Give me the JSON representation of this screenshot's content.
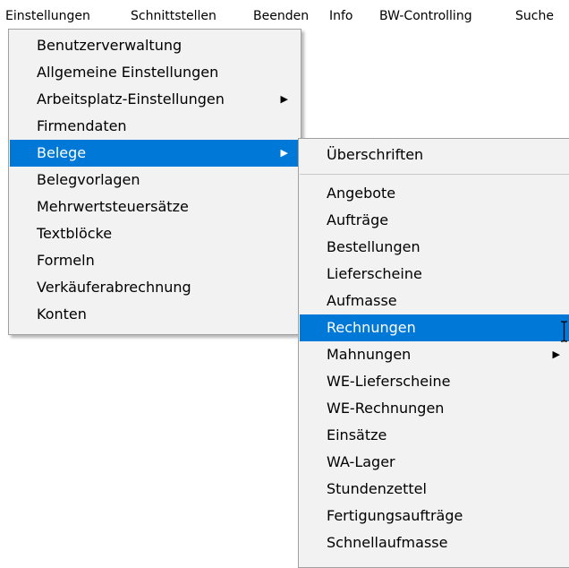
{
  "menubar": {
    "items": [
      {
        "label": "Einstellungen"
      },
      {
        "label": "Schnittstellen"
      },
      {
        "label": "Beenden"
      },
      {
        "label": "Info"
      },
      {
        "label": "BW-Controlling"
      },
      {
        "label": "Suche"
      }
    ]
  },
  "einstellungen_menu": {
    "items": [
      {
        "label": "Benutzerverwaltung"
      },
      {
        "label": "Allgemeine Einstellungen"
      },
      {
        "label": "Arbeitsplatz-Einstellungen",
        "submenu_icon": "chevron-right-icon"
      },
      {
        "label": "Firmendaten"
      },
      {
        "label": "Belege",
        "selected": true,
        "submenu_icon": "chevron-right-icon"
      },
      {
        "label": "Belegvorlagen"
      },
      {
        "label": "Mehrwertsteuersätze"
      },
      {
        "label": "Textblöcke"
      },
      {
        "label": "Formeln"
      },
      {
        "label": "Verkäuferabrechnung"
      },
      {
        "label": "Konten"
      }
    ]
  },
  "belege_submenu": {
    "items": [
      {
        "label": "Überschriften"
      },
      {
        "label": "Angebote"
      },
      {
        "label": "Aufträge"
      },
      {
        "label": "Bestellungen"
      },
      {
        "label": "Lieferscheine"
      },
      {
        "label": "Aufmasse"
      },
      {
        "label": "Rechnungen",
        "selected": true
      },
      {
        "label": "Mahnungen",
        "submenu_icon": "chevron-right-icon"
      },
      {
        "label": "WE-Lieferscheine"
      },
      {
        "label": "WE-Rechnungen"
      },
      {
        "label": "Einsätze"
      },
      {
        "label": "WA-Lager"
      },
      {
        "label": "Stundenzettel"
      },
      {
        "label": "Fertigungsaufträge"
      },
      {
        "label": "Schnellaufmasse"
      }
    ]
  },
  "colors": {
    "menu_background": "#f2f2f2",
    "selection": "#0078d7",
    "selection_text": "#ffffff",
    "menubar_background": "#ffffff"
  }
}
